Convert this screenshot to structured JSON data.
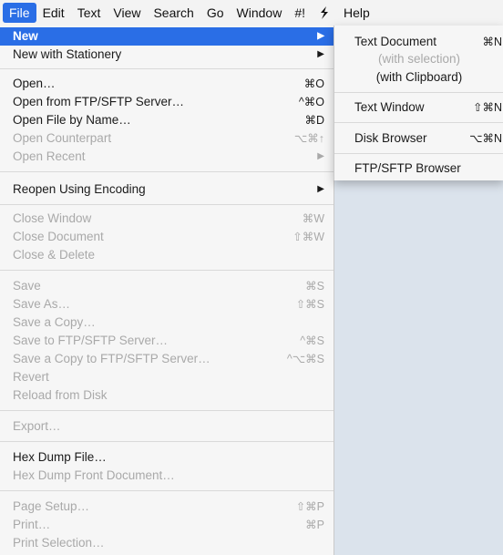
{
  "menubar": {
    "items": [
      "File",
      "Edit",
      "Text",
      "View",
      "Search",
      "Go",
      "Window",
      "#!",
      "Help"
    ],
    "script_icon": "lightning-script-icon"
  },
  "file_menu": {
    "new": {
      "label": "New"
    },
    "new_with_stationery": {
      "label": "New with Stationery"
    },
    "open": {
      "label": "Open…",
      "shortcut": "⌘O"
    },
    "open_ftp": {
      "label": "Open from FTP/SFTP Server…",
      "shortcut": "^⌘O"
    },
    "open_by_name": {
      "label": "Open File by Name…",
      "shortcut": "⌘D"
    },
    "open_counterpart": {
      "label": "Open Counterpart",
      "shortcut": "⌥⌘↑"
    },
    "open_recent": {
      "label": "Open Recent"
    },
    "reopen_encoding": {
      "label": "Reopen Using Encoding"
    },
    "close_window": {
      "label": "Close Window",
      "shortcut": "⌘W"
    },
    "close_document": {
      "label": "Close Document",
      "shortcut": "⇧⌘W"
    },
    "close_delete": {
      "label": "Close & Delete"
    },
    "save": {
      "label": "Save",
      "shortcut": "⌘S"
    },
    "save_as": {
      "label": "Save As…",
      "shortcut": "⇧⌘S"
    },
    "save_copy": {
      "label": "Save a Copy…"
    },
    "save_ftp": {
      "label": "Save to FTP/SFTP Server…",
      "shortcut": "^⌘S"
    },
    "save_copy_ftp": {
      "label": "Save a Copy to FTP/SFTP Server…",
      "shortcut": "^⌥⌘S"
    },
    "revert": {
      "label": "Revert"
    },
    "reload": {
      "label": "Reload from Disk"
    },
    "export": {
      "label": "Export…"
    },
    "hex_dump_file": {
      "label": "Hex Dump File…"
    },
    "hex_dump_front": {
      "label": "Hex Dump Front Document…"
    },
    "page_setup": {
      "label": "Page Setup…",
      "shortcut": "⇧⌘P"
    },
    "print": {
      "label": "Print…",
      "shortcut": "⌘P"
    },
    "print_selection": {
      "label": "Print Selection…"
    }
  },
  "new_submenu": {
    "text_document": {
      "label": "Text Document",
      "shortcut": "⌘N"
    },
    "with_selection": {
      "label": "(with selection)"
    },
    "with_clipboard": {
      "label": "(with Clipboard)"
    },
    "text_window": {
      "label": "Text Window",
      "shortcut": "⇧⌘N"
    },
    "disk_browser": {
      "label": "Disk Browser",
      "shortcut": "⌥⌘N"
    },
    "ftp_browser": {
      "label": "FTP/SFTP Browser"
    }
  },
  "colors": {
    "accent": "#2a6ee6",
    "disabled": "#a9a9a9"
  }
}
